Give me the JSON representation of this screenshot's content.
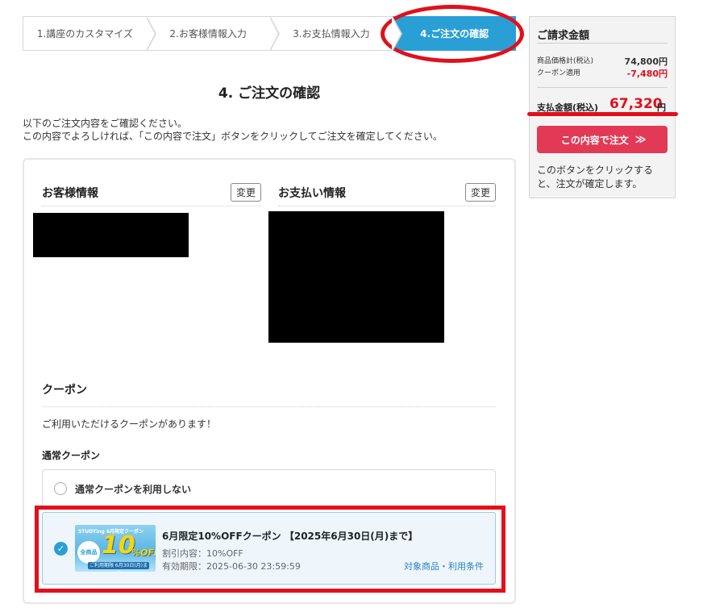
{
  "steps": [
    {
      "label": "1.講座のカスタマイズ"
    },
    {
      "label": "2.お客様情報入力"
    },
    {
      "label": "3.お支払情報入力"
    },
    {
      "label": "4.ご注文の確認"
    }
  ],
  "page": {
    "title": "4. ご注文の確認",
    "intro_line1": "以下のご注文内容をご確認ください。",
    "intro_line2": "この内容でよろしければ、「この内容で注文」ボタンをクリックしてご注文を確定してください。"
  },
  "customer": {
    "heading": "お客様情報",
    "change_label": "変更"
  },
  "payment": {
    "heading": "お支払い情報",
    "change_label": "変更"
  },
  "coupon": {
    "heading": "クーポン",
    "message": "ご利用いただけるクーポンがあります！",
    "type_label": "通常クーポン",
    "none_option": "通常クーポンを利用しない",
    "item": {
      "banner_top": "STUDYing 6月限定クーポン",
      "banner_left": "全商品",
      "banner_big": "10",
      "banner_off": "%OFF",
      "banner_bottom": "ご利用期限 6月30日(月)まで",
      "title": "6月限定10%OFFクーポン 【2025年6月30日(月)まで】",
      "discount": "割引内容：10%OFF",
      "expiry": "有効期限：2025-06-30 23:59:59",
      "terms_link": "対象商品・利用条件"
    }
  },
  "summary": {
    "heading": "ご請求金額",
    "subtotal_label": "商品価格計(税込)",
    "subtotal_value": "74,800円",
    "coupon_label": "クーポン適用",
    "coupon_value": "-7,480円",
    "total_label": "支払金額(税込)",
    "total_value": "67,320",
    "total_unit": "円",
    "order_button": "この内容で注文",
    "order_arrow": "≫",
    "note": "このボタンをクリックすると、注文が確定します。"
  },
  "colors": {
    "accent": "#2a9fd6",
    "order_button": "#e23a56",
    "annotation": "#e0101c"
  }
}
